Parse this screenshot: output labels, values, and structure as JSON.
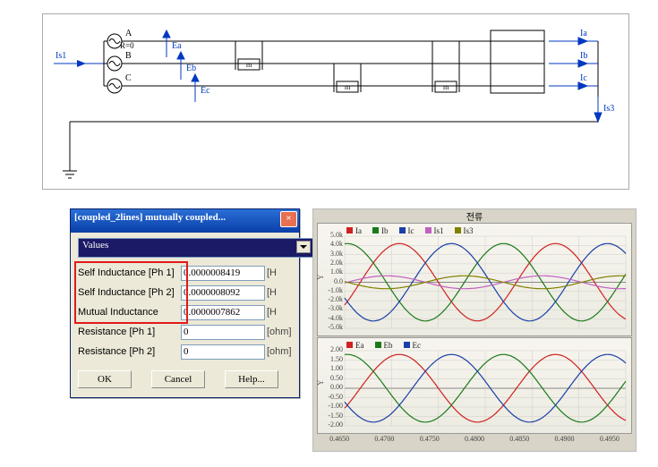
{
  "schematic": {
    "sources": {
      "a": "A",
      "b": "B",
      "c": "C"
    },
    "r_note": "R=0",
    "emf": {
      "a": "Ea",
      "b": "Eb",
      "c": "Ec"
    },
    "iin": "Is1",
    "iout": {
      "a": "Ia",
      "b": "Ib",
      "c": "Ic",
      "sum": "Is3"
    }
  },
  "dialog": {
    "title": "[coupled_2lines] mutually coupled...",
    "dropdown": "Values",
    "fields": [
      {
        "label": "Self Inductance [Ph 1]",
        "value": "0.0000008419",
        "unit": "[H"
      },
      {
        "label": "Self Inductance [Ph 2]",
        "value": "0.0000008092",
        "unit": "[H"
      },
      {
        "label": "Mutual Inductance",
        "value": "0.0000007862",
        "unit": "[H"
      },
      {
        "label": "Resistance [Ph 1]",
        "value": "0",
        "unit": "[ohm]"
      },
      {
        "label": "Resistance [Ph 2]",
        "value": "0",
        "unit": "[ohm]"
      }
    ],
    "buttons": {
      "ok": "OK",
      "cancel": "Cancel",
      "help": "Help..."
    }
  },
  "scope": {
    "title": "전류",
    "top": {
      "ylabel": "Y",
      "legend": [
        {
          "name": "Ia",
          "color": "#d02020"
        },
        {
          "name": "Ib",
          "color": "#1a7a1a"
        },
        {
          "name": "Ic",
          "color": "#1a3fa8"
        },
        {
          "name": "Is1",
          "color": "#c060c0"
        },
        {
          "name": "Is3",
          "color": "#808000"
        }
      ],
      "yticks": [
        "5.0k",
        "4.0k",
        "3.0k",
        "2.0k",
        "1.0k",
        "0.0",
        "-1.0k",
        "-2.0k",
        "-3.0k",
        "-4.0k",
        "-5.0k"
      ]
    },
    "bot": {
      "ylabel": "Y",
      "legend": [
        {
          "name": "Ea",
          "color": "#d02020"
        },
        {
          "name": "Eb",
          "color": "#1a7a1a"
        },
        {
          "name": "Ec",
          "color": "#1a3fa8"
        }
      ],
      "yticks": [
        "2.00",
        "1.50",
        "1.00",
        "0.50",
        "0.00",
        "-0.50",
        "-1.00",
        "-1.50",
        "-2.00"
      ]
    },
    "xticks": [
      "0.4650",
      "0.4700",
      "0.4750",
      "0.4800",
      "0.4850",
      "0.4900",
      "0.4950"
    ],
    "chart_data": {
      "type": "line",
      "xlim": [
        0.465,
        0.495
      ],
      "panels": [
        {
          "series": [
            {
              "name": "Ia",
              "amp": 4200,
              "phase": 0,
              "freq": 60
            },
            {
              "name": "Ib",
              "amp": 4200,
              "phase": 120,
              "freq": 60
            },
            {
              "name": "Ic",
              "amp": 4200,
              "phase": 240,
              "freq": 60
            },
            {
              "name": "Is1",
              "amp": 700,
              "phase": 30,
              "freq": 60
            },
            {
              "name": "Is3",
              "amp": 700,
              "phase": 210,
              "freq": 60
            }
          ],
          "ylim": [
            -5000,
            5000
          ]
        },
        {
          "series": [
            {
              "name": "Ea",
              "amp": 1.8,
              "phase": 0,
              "freq": 60
            },
            {
              "name": "Eb",
              "amp": 1.8,
              "phase": 120,
              "freq": 60
            },
            {
              "name": "Ec",
              "amp": 1.8,
              "phase": 240,
              "freq": 60
            }
          ],
          "ylim": [
            -2.0,
            2.0
          ]
        }
      ]
    }
  }
}
